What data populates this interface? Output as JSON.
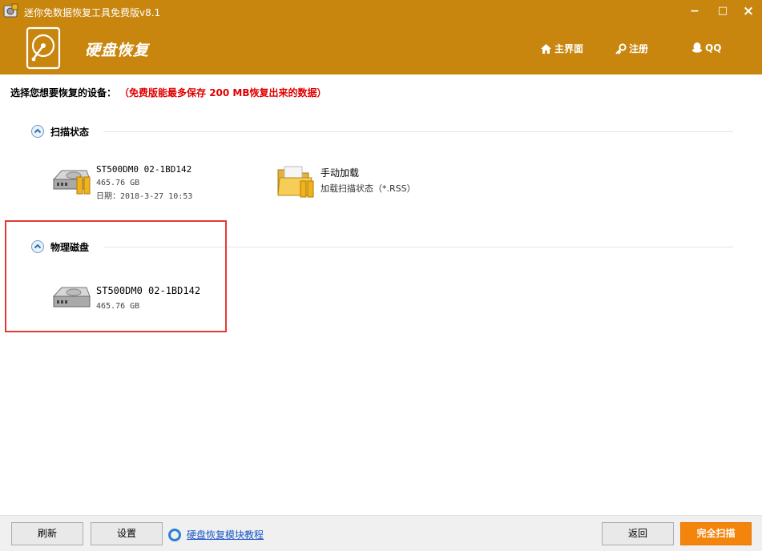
{
  "window": {
    "title": "迷你免数据恢复工具免费版v8.1",
    "minimize_glyph": "−",
    "maximize_glyph": "□",
    "close_glyph": "×"
  },
  "header": {
    "product_name": "硬盘恢复",
    "logo_icon": "hard-drive-logo-icon",
    "nav": [
      {
        "label": "主界面",
        "icon": "home-icon"
      },
      {
        "label": "注册",
        "icon": "key-icon"
      },
      {
        "label": "QQ",
        "icon": "qq-penguin-icon"
      }
    ]
  },
  "instruction": {
    "prompt": "选择您想要恢复的设备：",
    "note": "（免费版能最多保存 200 MB恢复出来的数据）"
  },
  "sections": {
    "scan_status": {
      "label": "扫描状态",
      "devices": [
        {
          "name": "ST500DM0 02-1BD142",
          "size": "465.76 GB",
          "date": "日期：2018-3-27 10:53",
          "icon": "hard-disk-icon"
        },
        {
          "name": "手动加载",
          "desc": "加载扫描状态（*.RSS）",
          "icon": "folder-icon"
        }
      ]
    },
    "physical_disks": {
      "label": "物理磁盘",
      "devices": [
        {
          "name": "ST500DM0 02-1BD142",
          "size": "465.76 GB",
          "icon": "hard-disk-icon"
        }
      ]
    }
  },
  "footer": {
    "refresh": "刷新",
    "settings": "设置",
    "help_link": "硬盘恢复模块教程",
    "back": "返回",
    "full_scan": "完全扫描"
  },
  "colors": {
    "brand": "#c8860e",
    "primary_button": "#f3840c",
    "note_red": "#e00000",
    "highlight_red": "#e53935",
    "link_blue": "#1a57c9"
  }
}
